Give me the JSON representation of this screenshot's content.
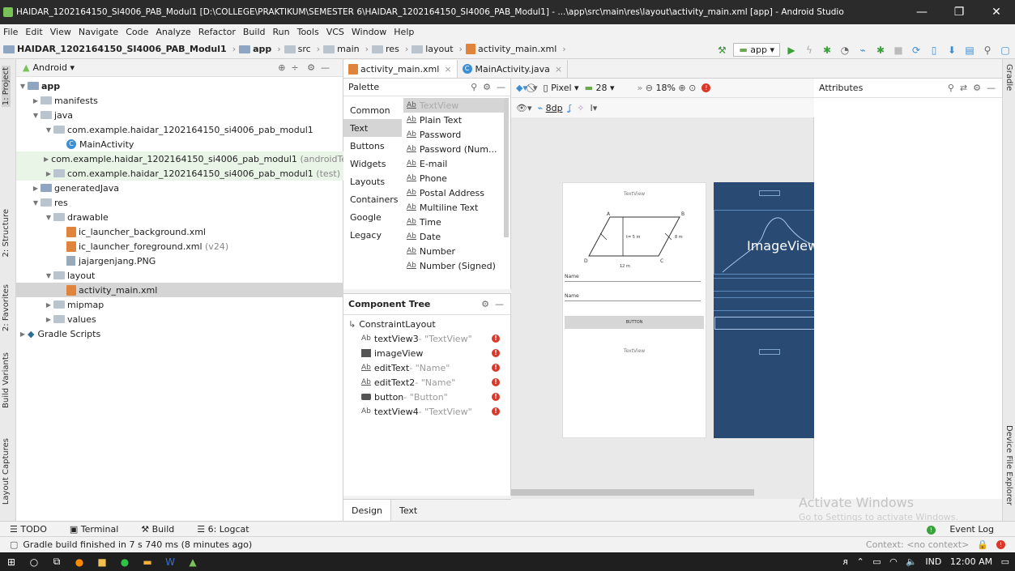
{
  "window": {
    "title": "HAIDAR_1202164150_SI4006_PAB_Modul1 [D:\\COLLEGE\\PRAKTIKUM\\SEMESTER 6\\HAIDAR_1202164150_SI4006_PAB_Modul1] - ...\\app\\src\\main\\res\\layout\\activity_main.xml [app] - Android Studio",
    "minimize": "—",
    "maximize": "❐",
    "close": "✕"
  },
  "menu": [
    "File",
    "Edit",
    "View",
    "Navigate",
    "Code",
    "Analyze",
    "Refactor",
    "Build",
    "Run",
    "Tools",
    "VCS",
    "Window",
    "Help"
  ],
  "breadcrumb": [
    "HAIDAR_1202164150_SI4006_PAB_Modul1",
    "app",
    "src",
    "main",
    "res",
    "layout",
    "activity_main.xml"
  ],
  "run_config": "app",
  "left_tabs": [
    "1: Project",
    "2: Structure",
    "2: Favorites",
    "Build Variants",
    "Layout Captures"
  ],
  "right_tabs": [
    "Gradle",
    "Device File Explorer"
  ],
  "project": {
    "view": "Android",
    "tree": [
      {
        "label": "app",
        "extra": "",
        "bold": true
      },
      {
        "label": "manifests",
        "extra": ""
      },
      {
        "label": "java",
        "extra": ""
      },
      {
        "label": "com.example.haidar_1202164150_si4006_pab_modul1",
        "extra": ""
      },
      {
        "label": "MainActivity",
        "extra": ""
      },
      {
        "label": "com.example.haidar_1202164150_si4006_pab_modul1",
        "extra": "(androidTest)"
      },
      {
        "label": "com.example.haidar_1202164150_si4006_pab_modul1",
        "extra": "(test)"
      },
      {
        "label": "generatedJava",
        "extra": ""
      },
      {
        "label": "res",
        "extra": ""
      },
      {
        "label": "drawable",
        "extra": ""
      },
      {
        "label": "ic_launcher_background.xml",
        "extra": ""
      },
      {
        "label": "ic_launcher_foreground.xml",
        "extra": "(v24)"
      },
      {
        "label": "jajargenjang.PNG",
        "extra": ""
      },
      {
        "label": "layout",
        "extra": ""
      },
      {
        "label": "activity_main.xml",
        "extra": ""
      },
      {
        "label": "mipmap",
        "extra": ""
      },
      {
        "label": "values",
        "extra": ""
      },
      {
        "label": "Gradle Scripts",
        "extra": ""
      }
    ]
  },
  "editor_tabs": [
    "activity_main.xml",
    "MainActivity.java"
  ],
  "palette": {
    "title": "Palette",
    "categories": [
      "Common",
      "Text",
      "Buttons",
      "Widgets",
      "Layouts",
      "Containers",
      "Google",
      "Legacy"
    ],
    "items": [
      "TextView",
      "Plain Text",
      "Password",
      "Password (Num...",
      "E-mail",
      "Phone",
      "Postal Address",
      "Multiline Text",
      "Time",
      "Date",
      "Number",
      "Number (Signed)"
    ]
  },
  "component_tree": {
    "title": "Component Tree",
    "root": "ConstraintLayout",
    "items": [
      {
        "id": "textView3",
        "text": "- \"TextView\""
      },
      {
        "id": "imageView",
        "text": ""
      },
      {
        "id": "editText",
        "text": "- \"Name\""
      },
      {
        "id": "editText2",
        "text": "- \"Name\""
      },
      {
        "id": "button",
        "text": "- \"Button\""
      },
      {
        "id": "textView4",
        "text": "- \"TextView\""
      }
    ]
  },
  "design_toolbar": {
    "device": "Pixel",
    "api": "28",
    "zoom": "18%",
    "margin": "8dp"
  },
  "preview": {
    "textview_top": "TextView",
    "name1": "Name",
    "name2": "Name",
    "button": "BUTTON",
    "textview_bottom": "TextView",
    "imageview": "ImageView",
    "shape_labels": {
      "a": "A",
      "b": "B",
      "c": "C",
      "d": "D",
      "t": "t= 5 m",
      "side": "8 m",
      "base": "12 m"
    }
  },
  "attributes": {
    "title": "Attributes"
  },
  "design_tabs": [
    "Design",
    "Text"
  ],
  "activation": {
    "line1": "Activate Windows",
    "line2": "Go to Settings to activate Windows."
  },
  "bottom_tools": [
    "TODO",
    "Terminal",
    "Build",
    "6: Logcat"
  ],
  "event_log": "Event Log",
  "status": {
    "message": "Gradle build finished in 7 s 740 ms (8 minutes ago)",
    "context": "Context: <no context>"
  },
  "taskbar": {
    "lang": "IND",
    "time": "12:00 AM"
  }
}
